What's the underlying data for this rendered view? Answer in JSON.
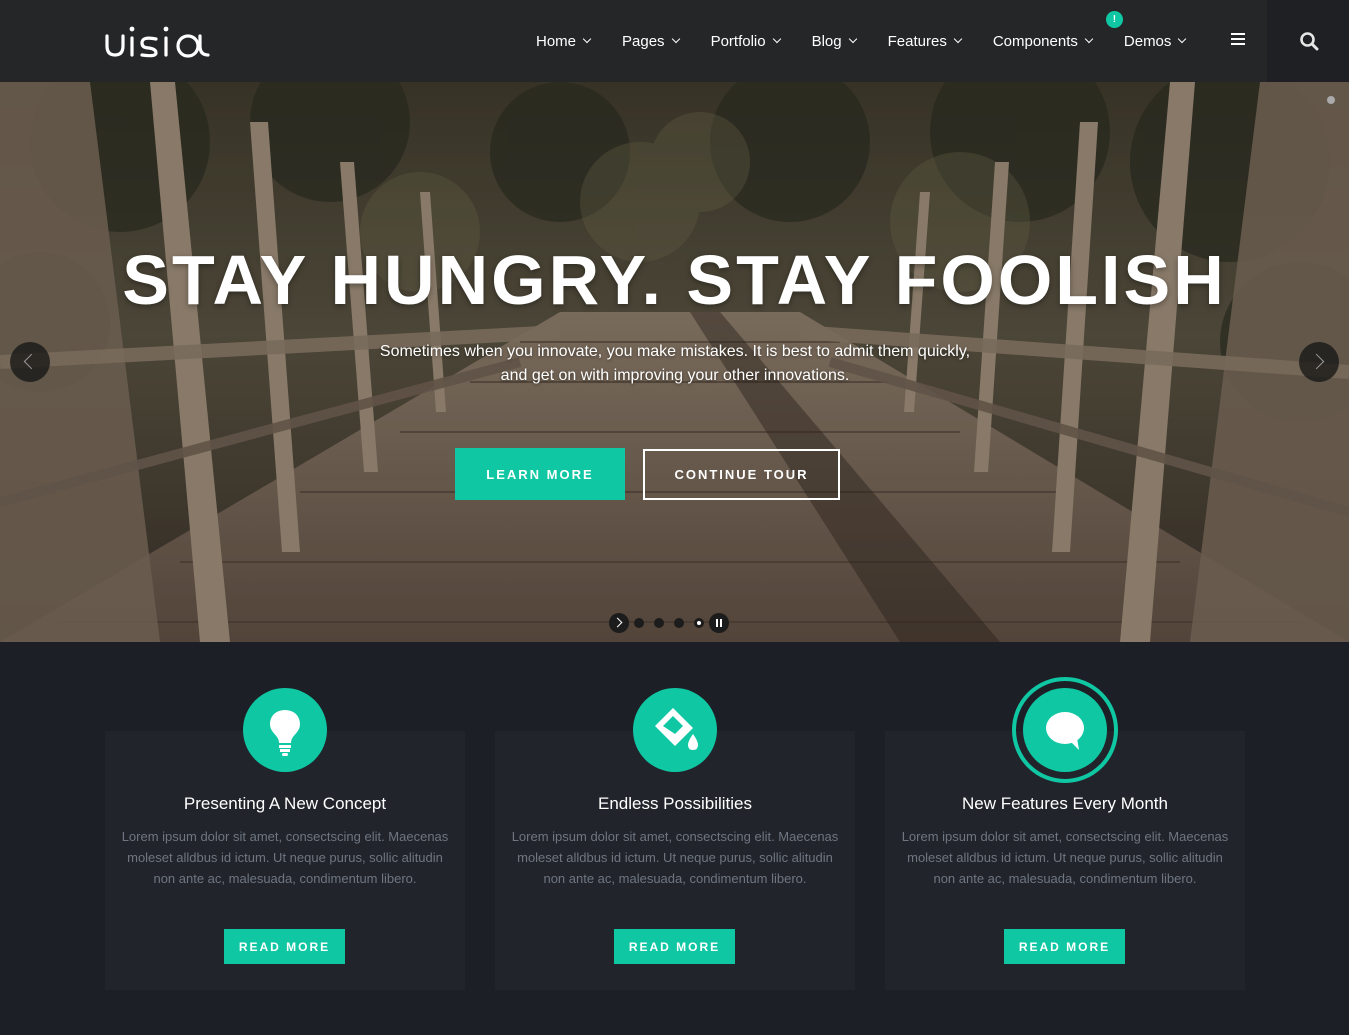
{
  "header": {
    "logo_text": "visio",
    "nav": [
      {
        "label": "Home"
      },
      {
        "label": "Pages"
      },
      {
        "label": "Portfolio"
      },
      {
        "label": "Blog"
      },
      {
        "label": "Features"
      },
      {
        "label": "Components"
      },
      {
        "label": "Demos",
        "badge": "!"
      }
    ],
    "menu_icon": "hamburger-icon",
    "search_icon": "search-icon"
  },
  "hero": {
    "title": "STAY HUNGRY. STAY FOOLISH",
    "subtitle_line1": "Sometimes when you innovate, you make mistakes. It is best to admit them quickly,",
    "subtitle_line2": "and get on with improving your other innovations.",
    "primary_button": "LEARN MORE",
    "secondary_button": "CONTINUE TOUR",
    "slide_count": 4,
    "active_slide": 4
  },
  "features": [
    {
      "icon": "lightbulb-icon",
      "title": "Presenting A New Concept",
      "text": "Lorem ipsum dolor sit amet, consectscing elit. Maecenas moleset alldbus id ictum. Ut neque purus, sollic alitudin non ante ac, malesuada, condimentum libero.",
      "button": "READ MORE"
    },
    {
      "icon": "paint-bucket-icon",
      "title": "Endless Possibilities",
      "text": "Lorem ipsum dolor sit amet, consectscing elit. Maecenas moleset alldbus id ictum. Ut neque purus, sollic alitudin non ante ac, malesuada, condimentum libero.",
      "button": "READ MORE"
    },
    {
      "icon": "chat-bubble-icon",
      "title": "New Features Every Month",
      "text": "Lorem ipsum dolor sit amet, consectscing elit. Maecenas moleset alldbus id ictum. Ut neque purus, sollic alitudin non ante ac, malesuada, condimentum libero.",
      "button": "READ MORE"
    }
  ],
  "colors": {
    "accent": "#10c7a4",
    "header_bg": "#252628",
    "section_bg": "#1c1f26",
    "card_bg": "#21242b"
  }
}
